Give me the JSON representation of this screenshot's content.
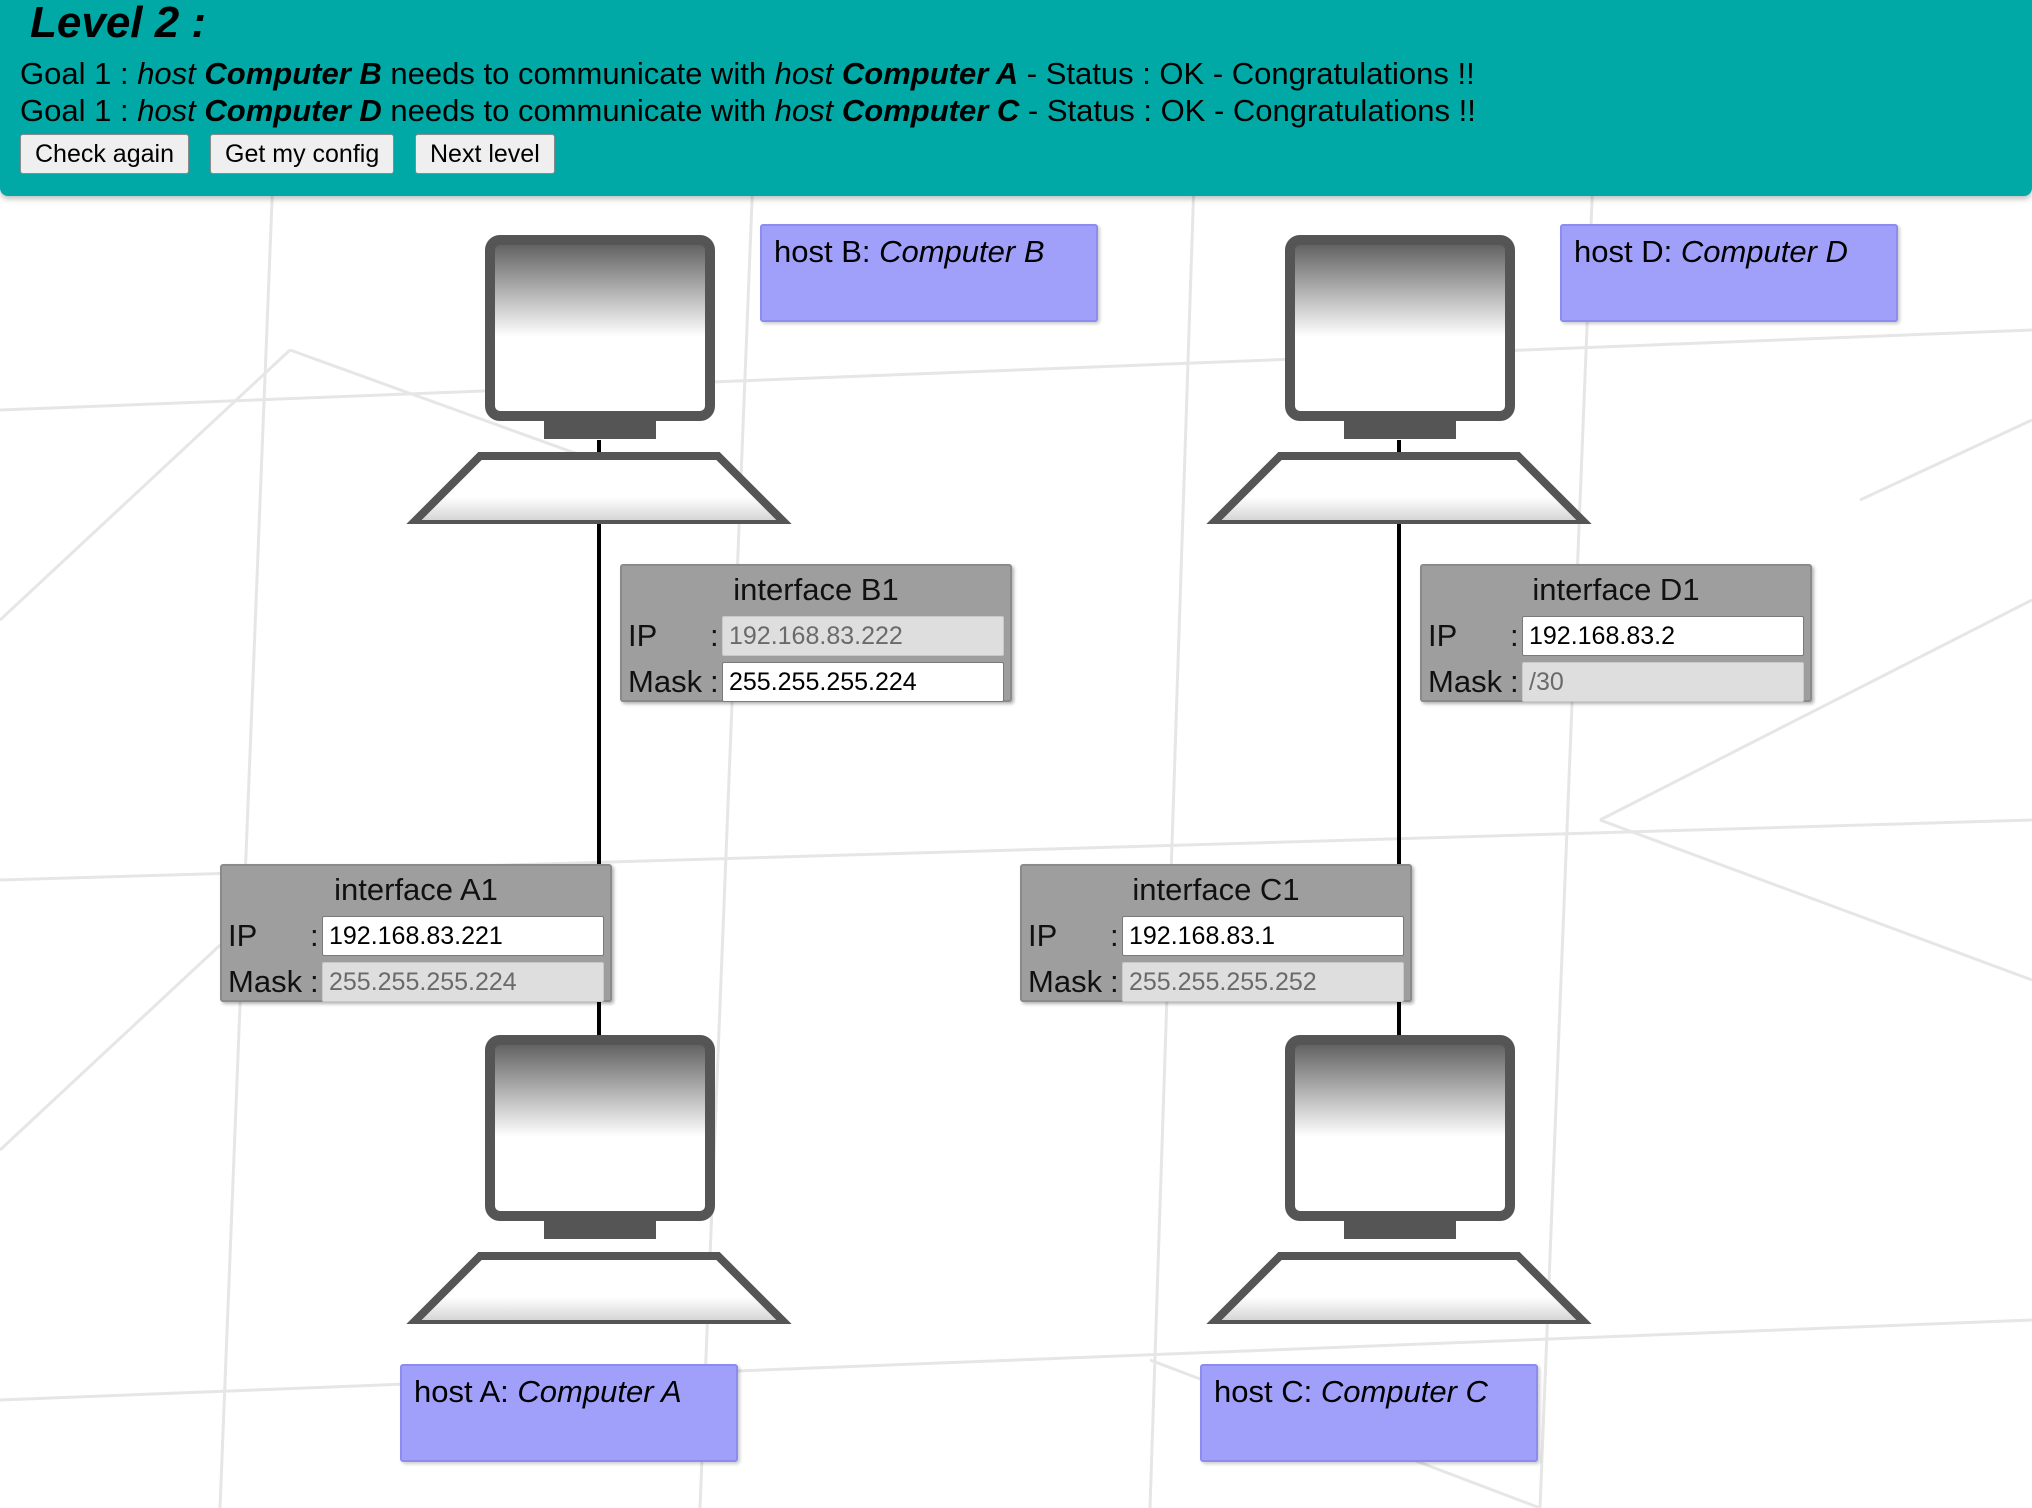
{
  "level": {
    "title": "Level 2 :"
  },
  "goals": [
    {
      "prefix": "Goal 1 : ",
      "host_word_1": "host",
      "source_host": "Computer B",
      "verb": " needs to communicate with ",
      "host_word_2": "host",
      "target_host": "Computer A",
      "status_text": " - Status : OK - Congratulations !!"
    },
    {
      "prefix": "Goal 1 : ",
      "host_word_1": "host",
      "source_host": "Computer D",
      "verb": " needs to communicate with ",
      "host_word_2": "host",
      "target_host": "Computer C",
      "status_text": " - Status : OK - Congratulations !!"
    }
  ],
  "buttons": {
    "check_again": "Check again",
    "get_config": "Get my config",
    "next_level": "Next level"
  },
  "hosts": {
    "A": {
      "prefix": "host A: ",
      "name": "Computer A"
    },
    "B": {
      "prefix": "host B: ",
      "name": "Computer B"
    },
    "C": {
      "prefix": "host C: ",
      "name": "Computer C"
    },
    "D": {
      "prefix": "host D: ",
      "name": "Computer D"
    }
  },
  "interfaces": {
    "B1": {
      "title": "interface B1",
      "ip_label": "IP",
      "mask_label": "Mask",
      "colon": ":",
      "ip": "192.168.83.222",
      "mask": "255.255.255.224",
      "ip_editable": false,
      "mask_editable": true
    },
    "A1": {
      "title": "interface A1",
      "ip_label": "IP",
      "mask_label": "Mask",
      "colon": ":",
      "ip": "192.168.83.221",
      "mask": "255.255.255.224",
      "ip_editable": true,
      "mask_editable": false
    },
    "D1": {
      "title": "interface D1",
      "ip_label": "IP",
      "mask_label": "Mask",
      "colon": ":",
      "ip": "192.168.83.2",
      "mask": "/30",
      "ip_editable": true,
      "mask_editable": false
    },
    "C1": {
      "title": "interface C1",
      "ip_label": "IP",
      "mask_label": "Mask",
      "colon": ":",
      "ip": "192.168.83.1",
      "mask": "255.255.255.252",
      "ip_editable": true,
      "mask_editable": false
    }
  },
  "colors": {
    "header": "#00a9a5",
    "host_label": "#a0a0fb",
    "interface_panel": "#9e9e9e"
  },
  "icons": {
    "computer": "computer-icon"
  }
}
